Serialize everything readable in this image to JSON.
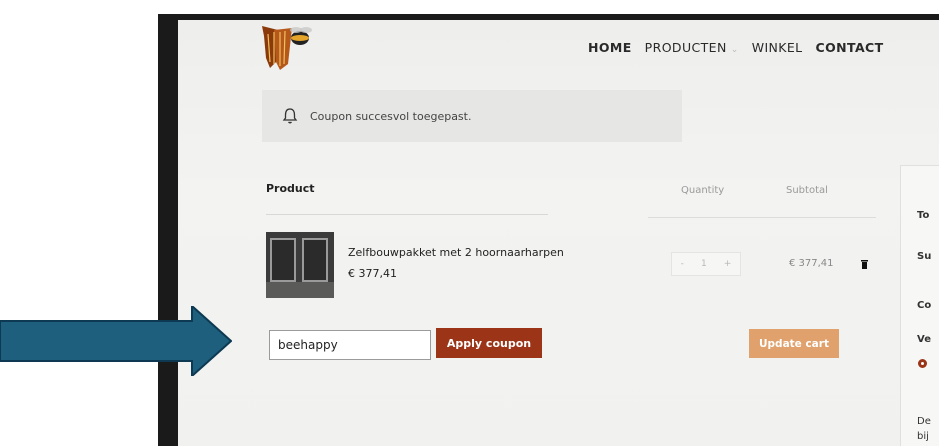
{
  "nav": {
    "items": [
      {
        "label": "HOME",
        "bold": true
      },
      {
        "label": "PRODUCTEN",
        "bold": false,
        "has_dropdown": true
      },
      {
        "label": "WINKEL",
        "bold": false
      },
      {
        "label": "CONTACT",
        "bold": true
      }
    ]
  },
  "notice": {
    "icon": "bell-icon",
    "text": "Coupon succesvol toegepast."
  },
  "cart": {
    "headers": {
      "product": "Product",
      "quantity": "Quantity",
      "subtotal": "Subtotal"
    },
    "items": [
      {
        "name": "Zelfbouwpakket met 2 hoornaarharpen",
        "price": "€ 377,41",
        "quantity": "1",
        "qty_minus": "-",
        "qty_plus": "+",
        "subtotal": "€ 377,41"
      }
    ],
    "coupon_value": "beehappy",
    "apply_coupon_label": "Apply coupon",
    "update_cart_label": "Update cart"
  },
  "totals_panel": {
    "partial_labels": [
      "To",
      "Su",
      "Co",
      "Ve",
      "De",
      "bij"
    ]
  },
  "colors": {
    "accent_dark": "#9c3417",
    "accent_light": "#e0a16c",
    "arrow": "#1e5f7d"
  }
}
